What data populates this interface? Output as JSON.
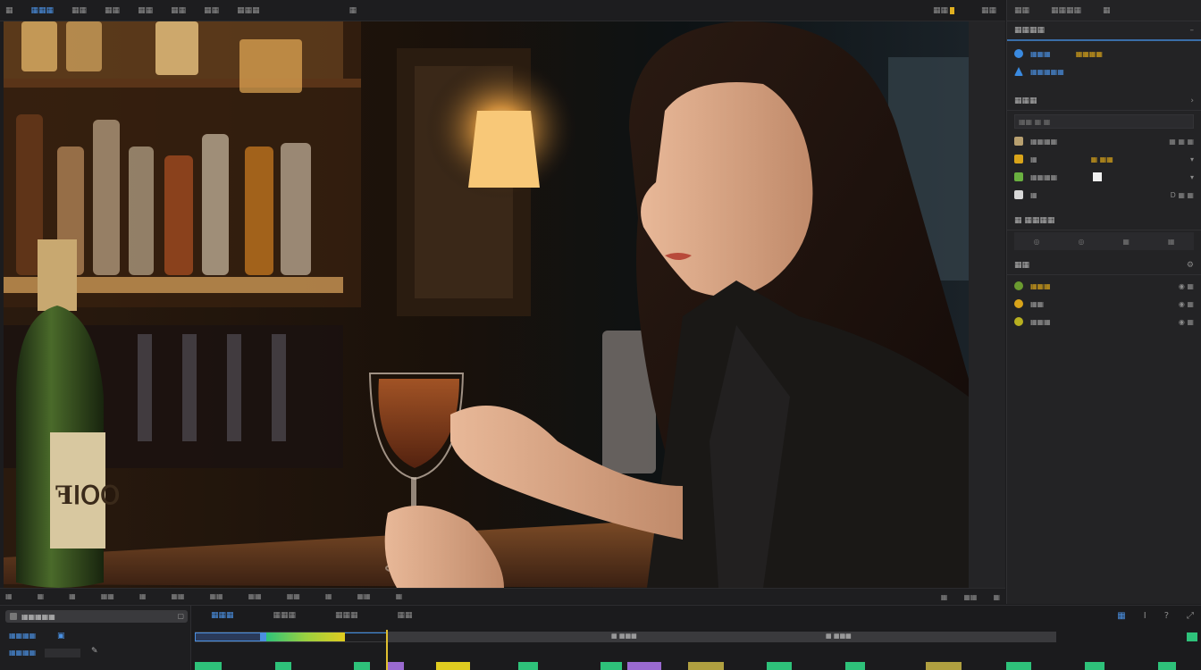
{
  "menu": {
    "items": [
      "▦",
      "▦▦▦",
      "▦▦",
      "▦▦",
      "▦▦",
      "▦▦",
      "▦▦",
      "▦▦▦",
      "▦"
    ],
    "active_index": 1,
    "right_items": [
      "▦▦",
      "▦▦",
      "▦▦"
    ]
  },
  "viewer": {
    "bottle_label": "ꟻꓲꓳꓳ"
  },
  "viewer_toolbar": {
    "left": [
      "▦",
      "▦",
      "▦",
      "▦▦",
      "▦",
      "▦▦",
      "▦▦",
      "▦▦",
      "▦▦",
      "▦",
      "▦▦",
      "▦"
    ],
    "right": [
      "▦",
      "▦▦",
      "▦"
    ]
  },
  "right_panel": {
    "tabs": [
      "▦▦",
      "▦▦▦▦",
      "▦"
    ],
    "section1_title": "▦▦▦▦",
    "rows1": [
      {
        "label": "▦▦▦",
        "tag": "▦▦▦▦",
        "tag_color": "blue"
      },
      {
        "label": "▦▦▦▦▦",
        "tag": "",
        "tag_color": ""
      }
    ],
    "section2_title": "▦▦▦",
    "field_value": "▦▦ ▦ ▦",
    "rows2": [
      {
        "label": "▦▦▦▦",
        "val": "▦ ▦ ▦"
      },
      {
        "label": "▦",
        "tag": "▦ ▦▦",
        "val": "▾"
      },
      {
        "label": "▦▦▦▦",
        "val": "▾"
      },
      {
        "label": "▦",
        "val": "D ▦ ▦"
      }
    ],
    "section3_title": "▦ ▦▦▦▦",
    "icon_row": [
      "◎",
      "◎",
      "▦",
      "▦"
    ],
    "section4_title": "▦▦",
    "rows3": [
      {
        "label": "▦▦▦",
        "color": "#6a9a30"
      },
      {
        "label": "▦▦",
        "color": "#d9a41a"
      },
      {
        "label": "▦▦▦",
        "color": "#b8b020"
      }
    ]
  },
  "timeline": {
    "search_value": "▦▦▦▦▦",
    "left_labels": [
      "▦▦▦▦",
      "▦▦▦▦"
    ],
    "tabs": [
      "▦▦▦",
      "▦▦▦",
      "▦▦▦",
      "▦▦"
    ],
    "active_tab": 0,
    "tools": [
      "▦",
      "I",
      "?",
      "⤢"
    ],
    "ruler_text_left": "▦ ▦▦▦",
    "ruler_text_mid": "▦ ▦▦▦",
    "ruler_text_right": "▦ ▦▦▦"
  },
  "colors": {
    "accent": "#4a8fe0",
    "playhead": "#e0c030",
    "clip_green": "#2ec27a",
    "clip_yellow": "#e0cc20",
    "clip_purple": "#9a6ad0"
  }
}
